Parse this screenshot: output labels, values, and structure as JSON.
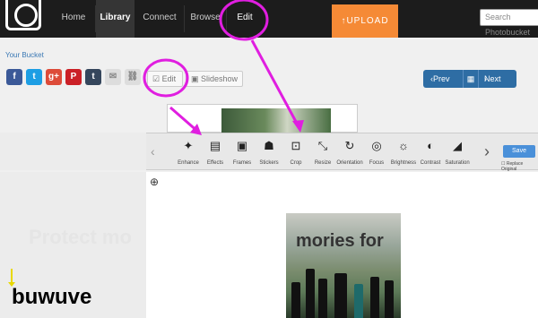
{
  "nav": {
    "items": [
      "Home",
      "Library",
      "Connect",
      "Browse",
      "Edit"
    ],
    "upload_label": "UPLOAD",
    "search_placeholder": "Search Photobucket"
  },
  "breadcrumb": "Your Bucket",
  "share": {
    "icons": [
      "facebook-icon",
      "twitter-icon",
      "google-plus-icon",
      "pinterest-icon",
      "tumblr-icon",
      "email-icon",
      "link-icon"
    ],
    "glyphs": [
      "f",
      "t",
      "g+",
      "P",
      "t",
      "✉",
      "⛓"
    ],
    "colors": [
      "#3b5998",
      "#1d9ee4",
      "#dd4b39",
      "#cb2027",
      "#35465c",
      "#dddddd",
      "#dddddd"
    ]
  },
  "buttons": {
    "edit": "Edit",
    "slideshow": "Slideshow"
  },
  "pager": {
    "prev": "Prev",
    "next": "Next"
  },
  "tools": [
    {
      "label": "Enhance",
      "icon": "magic-wand-icon",
      "glyph": "✦"
    },
    {
      "label": "Effects",
      "icon": "effects-icon",
      "glyph": "▤"
    },
    {
      "label": "Frames",
      "icon": "frames-icon",
      "glyph": "▣"
    },
    {
      "label": "Stickers",
      "icon": "stickers-icon",
      "glyph": "☗"
    },
    {
      "label": "Crop",
      "icon": "crop-icon",
      "glyph": "⊡"
    },
    {
      "label": "Resize",
      "icon": "resize-icon",
      "glyph": "⤡"
    },
    {
      "label": "Orientation",
      "icon": "orientation-icon",
      "glyph": "↻"
    },
    {
      "label": "Focus",
      "icon": "focus-icon",
      "glyph": "◎"
    },
    {
      "label": "Brightness",
      "icon": "brightness-icon",
      "glyph": "☼"
    },
    {
      "label": "Contrast",
      "icon": "contrast-icon",
      "glyph": "◐"
    },
    {
      "label": "Saturation",
      "icon": "saturation-icon",
      "glyph": "◢"
    }
  ],
  "save_label": "Save",
  "replace_label": "Replace Original",
  "watermark_left": "Protect mo",
  "watermark_right": "mories for",
  "caption": "buwuve"
}
